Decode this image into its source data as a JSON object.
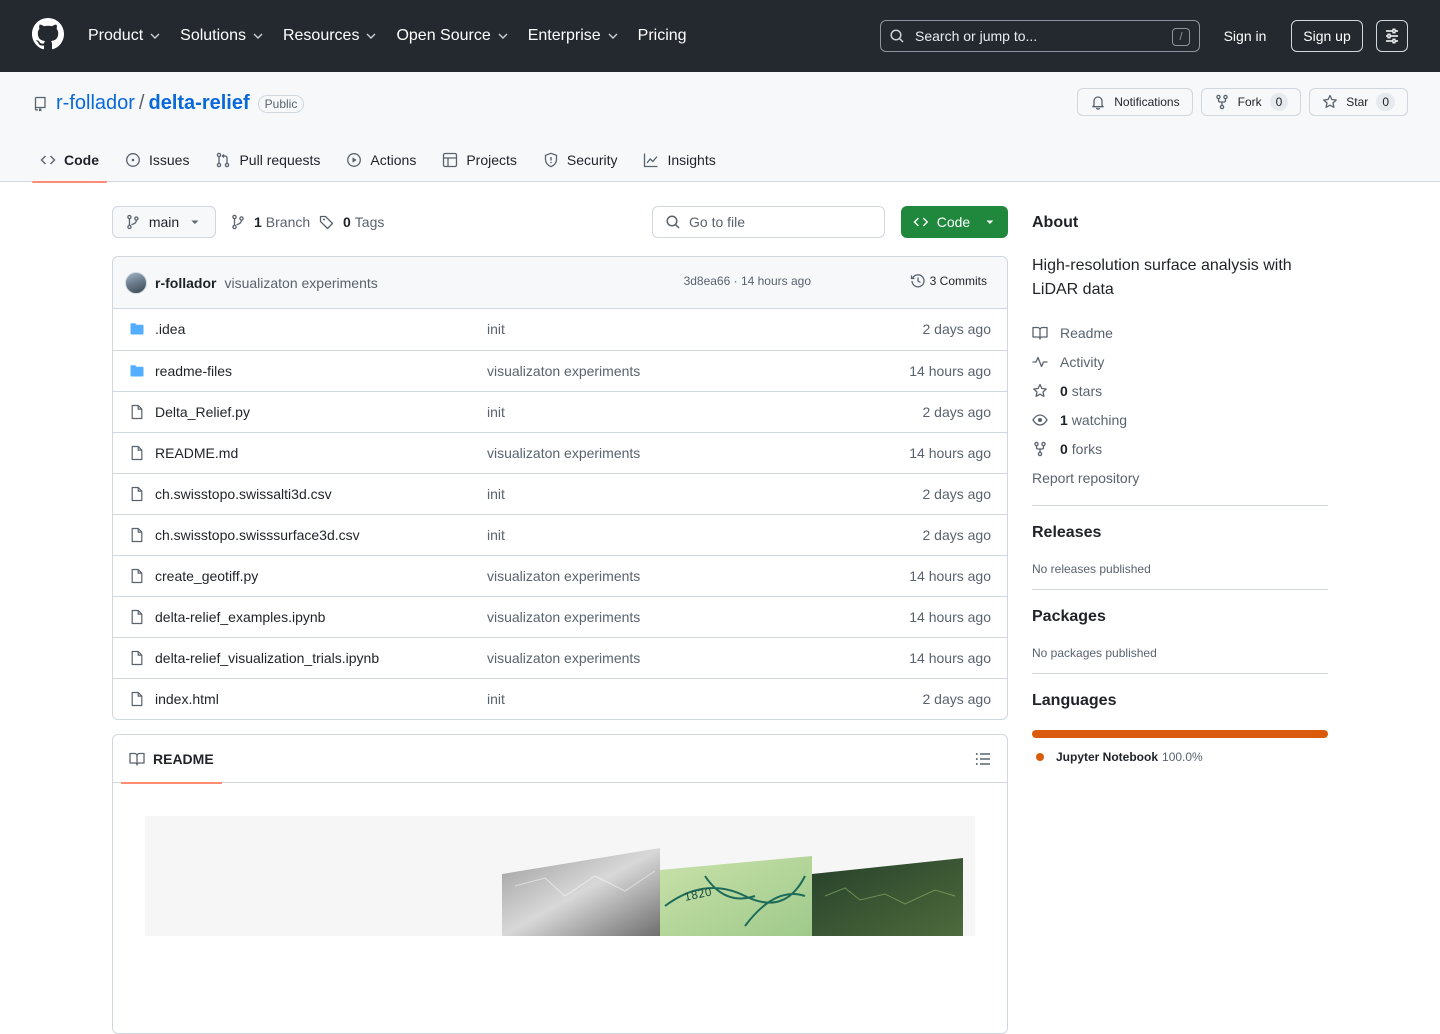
{
  "colors": {
    "header_bg": "#24292f",
    "link": "#0969da",
    "green_button": "#1f883d",
    "tab_underline": "#fd8c73",
    "folder": "#54aeff",
    "jupyter": "#DA5B0B"
  },
  "global_nav": {
    "items": [
      {
        "label": "Product"
      },
      {
        "label": "Solutions"
      },
      {
        "label": "Resources"
      },
      {
        "label": "Open Source"
      },
      {
        "label": "Enterprise"
      },
      {
        "label": "Pricing"
      }
    ],
    "search_placeholder": "Search or jump to...",
    "search_shortcut": "/",
    "sign_in": "Sign in",
    "sign_up": "Sign up"
  },
  "repo": {
    "owner": "r-follador",
    "separator": "/",
    "name": "delta-relief",
    "visibility": "Public",
    "notifications_label": "Notifications",
    "fork_label": "Fork",
    "fork_count": "0",
    "star_label": "Star",
    "star_count": "0",
    "tabs": [
      {
        "label": "Code",
        "icon": "code-icon"
      },
      {
        "label": "Issues",
        "icon": "issue-icon"
      },
      {
        "label": "Pull requests",
        "icon": "pull-request-icon"
      },
      {
        "label": "Actions",
        "icon": "play-icon"
      },
      {
        "label": "Projects",
        "icon": "table-icon"
      },
      {
        "label": "Security",
        "icon": "shield-icon"
      },
      {
        "label": "Insights",
        "icon": "graph-icon"
      }
    ]
  },
  "toolbar": {
    "branch": "main",
    "branch_count": "1",
    "branch_label": "Branch",
    "tag_count": "0",
    "tag_label": "Tags",
    "go_to_file": "Go to file",
    "code_label": "Code"
  },
  "latest_commit": {
    "author": "r-follador",
    "message": "visualizaton experiments",
    "hash_and_time": "3d8ea66 · 14 hours ago",
    "commits_label": "3 Commits"
  },
  "files": [
    {
      "name": ".idea",
      "type": "folder",
      "message": "init",
      "date": "2 days ago"
    },
    {
      "name": "readme-files",
      "type": "folder",
      "message": "visualizaton experiments",
      "date": "14 hours ago"
    },
    {
      "name": "Delta_Relief.py",
      "type": "file",
      "message": "init",
      "date": "2 days ago"
    },
    {
      "name": "README.md",
      "type": "file",
      "message": "visualizaton experiments",
      "date": "14 hours ago"
    },
    {
      "name": "ch.swisstopo.swissalti3d.csv",
      "type": "file",
      "message": "init",
      "date": "2 days ago"
    },
    {
      "name": "ch.swisstopo.swisssurface3d.csv",
      "type": "file",
      "message": "init",
      "date": "2 days ago"
    },
    {
      "name": "create_geotiff.py",
      "type": "file",
      "message": "visualizaton experiments",
      "date": "14 hours ago"
    },
    {
      "name": "delta-relief_examples.ipynb",
      "type": "file",
      "message": "visualizaton experiments",
      "date": "14 hours ago"
    },
    {
      "name": "delta-relief_visualization_trials.ipynb",
      "type": "file",
      "message": "visualizaton experiments",
      "date": "14 hours ago"
    },
    {
      "name": "index.html",
      "type": "file",
      "message": "init",
      "date": "2 days ago"
    }
  ],
  "readme": {
    "tab_label": "README",
    "image_text": "1820"
  },
  "about": {
    "title": "About",
    "description": "High-resolution surface analysis with LiDAR data",
    "readme": "Readme",
    "activity": "Activity",
    "stars_count": "0",
    "stars_label": "stars",
    "watching_count": "1",
    "watching_label": "watching",
    "forks_count": "0",
    "forks_label": "forks",
    "report": "Report repository"
  },
  "releases": {
    "title": "Releases",
    "note": "No releases published"
  },
  "packages": {
    "title": "Packages",
    "note": "No packages published"
  },
  "languages": {
    "title": "Languages",
    "items": [
      {
        "name": "Jupyter Notebook",
        "percent": "100.0%",
        "share": 1.0,
        "color": "#DA5B0B"
      }
    ]
  }
}
